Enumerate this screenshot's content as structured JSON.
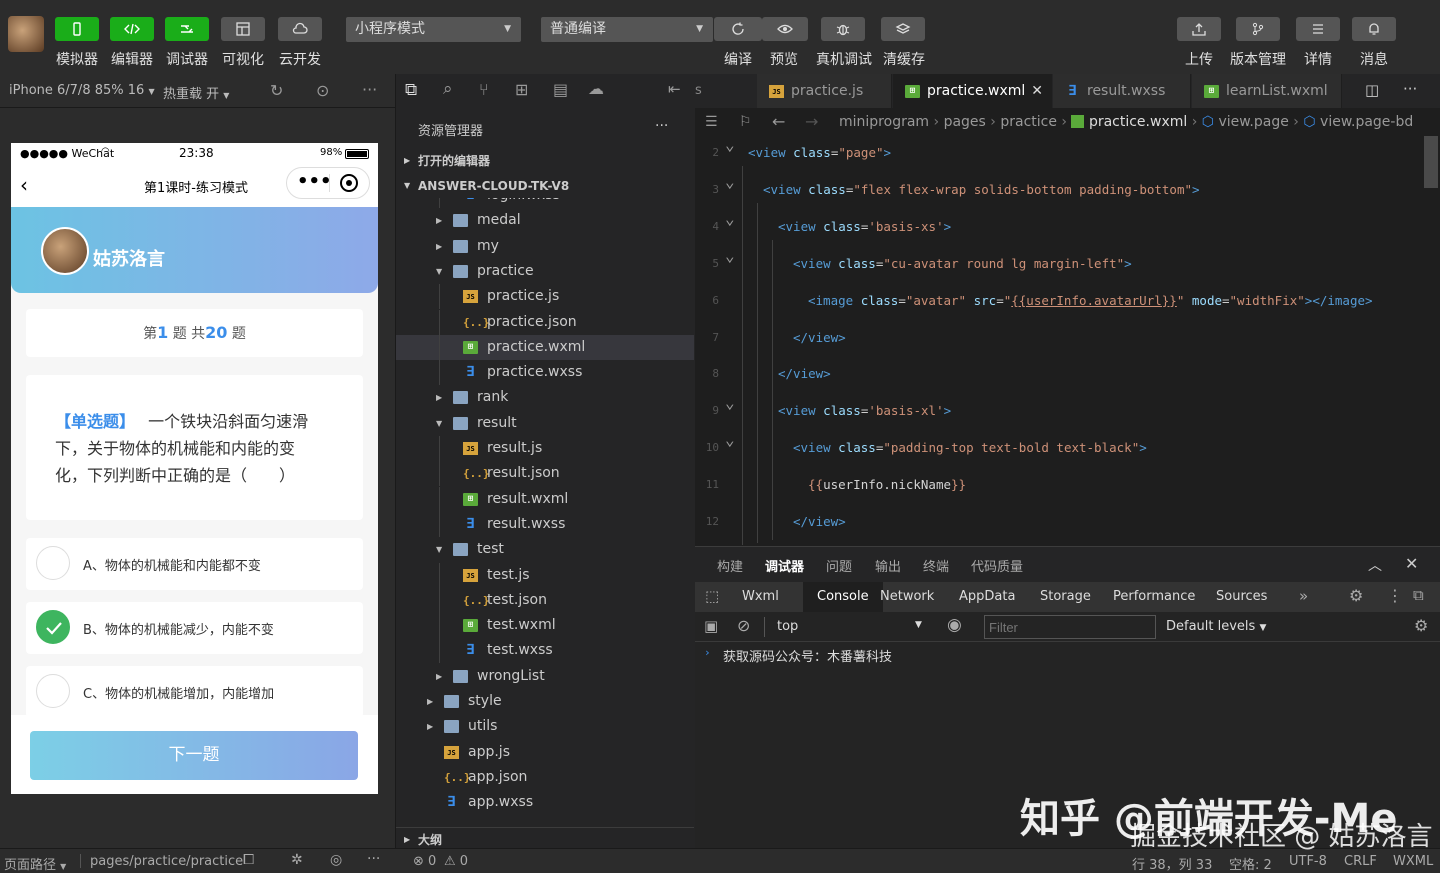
{
  "toolbar": {
    "buttons": [
      {
        "label": "模拟器",
        "icon": "phone-icon"
      },
      {
        "label": "编辑器",
        "icon": "code-icon"
      },
      {
        "label": "调试器",
        "icon": "debug-icon"
      },
      {
        "label": "可视化",
        "icon": "layout-icon"
      },
      {
        "label": "云开发",
        "icon": "cloud-icon"
      }
    ],
    "mode_select": "小程序模式",
    "compile_select": "普通编译",
    "actions": [
      {
        "label": "编译",
        "icon": "refresh-icon"
      },
      {
        "label": "预览",
        "icon": "eye-icon"
      },
      {
        "label": "真机调试",
        "icon": "bug-icon"
      },
      {
        "label": "清缓存",
        "icon": "layers-icon"
      }
    ],
    "right_actions": [
      {
        "label": "上传",
        "icon": "upload-icon"
      },
      {
        "label": "版本管理",
        "icon": "branch-icon"
      },
      {
        "label": "详情",
        "icon": "menu-icon"
      },
      {
        "label": "消息",
        "icon": "bell-icon"
      }
    ]
  },
  "simbar": {
    "device": "iPhone 6/7/8 85% 16",
    "hot_reload": "热重载 开"
  },
  "phone": {
    "carrier": "●●●●● WeChat",
    "time": "23:38",
    "battery": "98%",
    "nav_title": "第1课时-练习模式",
    "nickname": "姑苏洛言",
    "progress_prefix": "第",
    "progress_current": "1",
    "progress_middle": "题 共",
    "progress_total": "20",
    "progress_suffix": "题",
    "question_type": "【单选题】",
    "question_line1": "一个铁块沿斜面匀速滑",
    "question_line2": "下，关于物体的机械能和内能的变",
    "question_line3": "化，下列判断中正确的是（　　）",
    "options": [
      {
        "text": "A、物体的机械能和内能都不变",
        "checked": false
      },
      {
        "text": "B、物体的机械能减少，内能不变",
        "checked": true
      },
      {
        "text": "C、物体的机械能增加，内能增加",
        "checked": false
      }
    ],
    "next_button": "下一题"
  },
  "explorer": {
    "title": "资源管理器",
    "open_editors": "打开的编辑器",
    "project": "ANSWER-CLOUD-TK-V8",
    "outline": "大纲",
    "items": [
      {
        "label": "login.wxss",
        "type": "wxss",
        "depth": 2,
        "arrow": ""
      },
      {
        "label": "medal",
        "type": "folder",
        "depth": 1,
        "arrow": "▸"
      },
      {
        "label": "my",
        "type": "folder",
        "depth": 1,
        "arrow": "▸"
      },
      {
        "label": "practice",
        "type": "folder-open",
        "depth": 1,
        "arrow": "▾"
      },
      {
        "label": "practice.js",
        "type": "js",
        "depth": 2,
        "arrow": ""
      },
      {
        "label": "practice.json",
        "type": "json",
        "depth": 2,
        "arrow": ""
      },
      {
        "label": "practice.wxml",
        "type": "wxml",
        "depth": 2,
        "arrow": "",
        "selected": true
      },
      {
        "label": "practice.wxss",
        "type": "wxss",
        "depth": 2,
        "arrow": ""
      },
      {
        "label": "rank",
        "type": "folder",
        "depth": 1,
        "arrow": "▸"
      },
      {
        "label": "result",
        "type": "folder-open",
        "depth": 1,
        "arrow": "▾"
      },
      {
        "label": "result.js",
        "type": "js",
        "depth": 2,
        "arrow": ""
      },
      {
        "label": "result.json",
        "type": "json",
        "depth": 2,
        "arrow": ""
      },
      {
        "label": "result.wxml",
        "type": "wxml",
        "depth": 2,
        "arrow": ""
      },
      {
        "label": "result.wxss",
        "type": "wxss",
        "depth": 2,
        "arrow": ""
      },
      {
        "label": "test",
        "type": "folder-open",
        "depth": 1,
        "arrow": "▾"
      },
      {
        "label": "test.js",
        "type": "js",
        "depth": 2,
        "arrow": ""
      },
      {
        "label": "test.json",
        "type": "json",
        "depth": 2,
        "arrow": ""
      },
      {
        "label": "test.wxml",
        "type": "wxml",
        "depth": 2,
        "arrow": ""
      },
      {
        "label": "test.wxss",
        "type": "wxss",
        "depth": 2,
        "arrow": ""
      },
      {
        "label": "wrongList",
        "type": "folder",
        "depth": 1,
        "arrow": "▸"
      },
      {
        "label": "style",
        "type": "folder",
        "depth": 0,
        "arrow": "▸"
      },
      {
        "label": "utils",
        "type": "folder",
        "depth": 0,
        "arrow": "▸"
      },
      {
        "label": "app.js",
        "type": "js",
        "depth": 0,
        "arrow": ""
      },
      {
        "label": "app.json",
        "type": "json",
        "depth": 0,
        "arrow": ""
      },
      {
        "label": "app.wxss",
        "type": "wxss",
        "depth": 0,
        "arrow": ""
      }
    ]
  },
  "tabs": [
    {
      "label": "practice.js",
      "icon": "js"
    },
    {
      "label": "practice.wxml",
      "icon": "wxml",
      "active": true
    },
    {
      "label": "result.wxss",
      "icon": "wxss"
    },
    {
      "label": "learnList.wxml",
      "icon": "wxml"
    }
  ],
  "tab_prefix": "s",
  "breadcrumb": [
    "miniprogram",
    "pages",
    "practice",
    "practice.wxml",
    "view.page",
    "view.page-bd"
  ],
  "code_lines": [
    {
      "n": "2",
      "fold": true,
      "indent": 0,
      "html": "<span class='c-tag'>&lt;view</span> <span class='c-attr'>class</span>=<span class='c-str'>\"page\"</span><span class='c-tag'>&gt;</span>"
    },
    {
      "n": "3",
      "fold": true,
      "indent": 1,
      "html": "<span class='c-tag'>&lt;view</span> <span class='c-attr'>class</span>=<span class='c-str'>\"flex flex-wrap solids-bottom padding-bottom\"</span><span class='c-tag'>&gt;</span>"
    },
    {
      "n": "4",
      "fold": true,
      "indent": 2,
      "html": "<span class='c-tag'>&lt;view</span> <span class='c-attr'>class</span>=<span class='c-str'>'basis-xs'</span><span class='c-tag'>&gt;</span>"
    },
    {
      "n": "5",
      "fold": true,
      "indent": 3,
      "html": "<span class='c-tag'>&lt;view</span> <span class='c-attr'>class</span>=<span class='c-str'>\"cu-avatar round lg margin-left\"</span><span class='c-tag'>&gt;</span>"
    },
    {
      "n": "6",
      "fold": false,
      "indent": 4,
      "html": "<span class='c-tag'>&lt;image</span> <span class='c-attr'>class</span>=<span class='c-str'>\"avatar\"</span> <span class='c-attr'>src</span>=<span class='c-str'>\"<u>{{userInfo.avatarUrl}}</u>\"</span> <span class='c-attr'>mode</span>=<span class='c-str'>\"widthFix\"</span><span class='c-tag'>&gt;&lt;/image&gt;</span>"
    },
    {
      "n": "7",
      "fold": false,
      "indent": 3,
      "html": "<span class='c-tag'>&lt;/view&gt;</span>"
    },
    {
      "n": "8",
      "fold": false,
      "indent": 2,
      "html": "<span class='c-tag'>&lt;/view&gt;</span>"
    },
    {
      "n": "9",
      "fold": true,
      "indent": 2,
      "html": "<span class='c-tag'>&lt;view</span> <span class='c-attr'>class</span>=<span class='c-str'>'basis-xl'</span><span class='c-tag'>&gt;</span>"
    },
    {
      "n": "10",
      "fold": true,
      "indent": 3,
      "html": "<span class='c-tag'>&lt;view</span> <span class='c-attr'>class</span>=<span class='c-str'>\"padding-top text-bold text-black\"</span><span class='c-tag'>&gt;</span>"
    },
    {
      "n": "11",
      "fold": false,
      "indent": 4,
      "html": "<span class='c-str'>{{</span><span class='c-mus'>userInfo.nickName</span><span class='c-str'>}}</span>"
    },
    {
      "n": "12",
      "fold": false,
      "indent": 3,
      "html": "<span class='c-tag'>&lt;/view&gt;</span>"
    }
  ],
  "devtools": {
    "panel_tabs": [
      "构建",
      "调试器",
      "问题",
      "输出",
      "终端",
      "代码质量"
    ],
    "active_panel": "调试器",
    "sub_tabs": [
      "Wxml",
      "Console",
      "Network",
      "AppData",
      "Storage",
      "Performance",
      "Sources"
    ],
    "active_sub": "Console",
    "context": "top",
    "filter_placeholder": "Filter",
    "levels": "Default levels",
    "console_message": "获取源码公众号：木番薯科技"
  },
  "status": {
    "page_path_label": "页面路径",
    "page_path": "pages/practice/practice",
    "errors": "0",
    "warnings": "0",
    "cursor": "行 38，列 33",
    "spaces": "空格: 2",
    "encoding": "UTF-8",
    "eol": "CRLF",
    "lang": "WXML"
  },
  "watermark": {
    "line1": "知乎 @前端开发-Me",
    "line2": "掘金技术社区 @ 姑苏洛言"
  },
  "colors": {
    "green": "#1aad19",
    "accent_blue": "#3b8eea",
    "check_green": "#3eb55f"
  }
}
